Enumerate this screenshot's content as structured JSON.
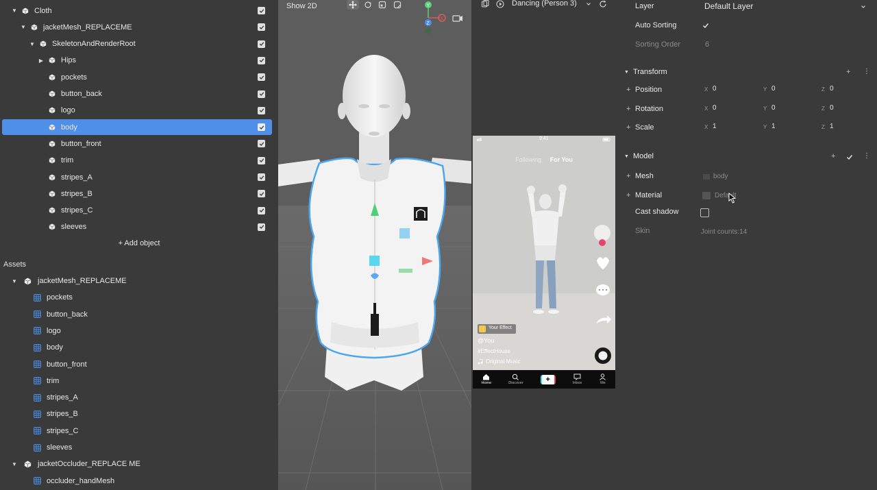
{
  "hierarchy": [
    {
      "label": "Cloth",
      "level": 0,
      "caret": "down",
      "icon": "object",
      "selected": false
    },
    {
      "label": "jacketMesh_REPLACEME",
      "level": 1,
      "caret": "down",
      "icon": "object",
      "selected": false
    },
    {
      "label": "SkeletonAndRenderRoot",
      "level": 2,
      "caret": "down",
      "icon": "object",
      "selected": false
    },
    {
      "label": "Hips",
      "level": 3,
      "caret": "right",
      "icon": "object",
      "selected": false
    },
    {
      "label": "pockets",
      "level": 3,
      "caret": "none",
      "icon": "object",
      "selected": false
    },
    {
      "label": "button_back",
      "level": 3,
      "caret": "none",
      "icon": "object",
      "selected": false
    },
    {
      "label": "logo",
      "level": 3,
      "caret": "none",
      "icon": "object",
      "selected": false
    },
    {
      "label": "body",
      "level": 3,
      "caret": "none",
      "icon": "object",
      "selected": true
    },
    {
      "label": "button_front",
      "level": 3,
      "caret": "none",
      "icon": "object",
      "selected": false
    },
    {
      "label": "trim",
      "level": 3,
      "caret": "none",
      "icon": "object",
      "selected": false
    },
    {
      "label": "stripes_A",
      "level": 3,
      "caret": "none",
      "icon": "object",
      "selected": false
    },
    {
      "label": "stripes_B",
      "level": 3,
      "caret": "none",
      "icon": "object",
      "selected": false
    },
    {
      "label": "stripes_C",
      "level": 3,
      "caret": "none",
      "icon": "object",
      "selected": false
    },
    {
      "label": "sleeves",
      "level": 3,
      "caret": "none",
      "icon": "object",
      "selected": false
    }
  ],
  "add_object_label": "+ Add object",
  "assets": {
    "title": "Assets",
    "items": [
      {
        "label": "jacketMesh_REPLACEME",
        "type": "group"
      },
      {
        "label": "pockets",
        "type": "mesh"
      },
      {
        "label": "button_back",
        "type": "mesh"
      },
      {
        "label": "logo",
        "type": "mesh"
      },
      {
        "label": "body",
        "type": "mesh"
      },
      {
        "label": "button_front",
        "type": "mesh"
      },
      {
        "label": "trim",
        "type": "mesh"
      },
      {
        "label": "stripes_A",
        "type": "mesh"
      },
      {
        "label": "stripes_B",
        "type": "mesh"
      },
      {
        "label": "stripes_C",
        "type": "mesh"
      },
      {
        "label": "sleeves",
        "type": "mesh"
      },
      {
        "label": "jacketOccluder_REPLACE ME",
        "type": "group"
      },
      {
        "label": "occluder_handMesh",
        "type": "mesh"
      }
    ]
  },
  "viewport": {
    "show2d_label": "Show 2D",
    "tools": [
      "move-tool-icon",
      "rotate-tool-icon",
      "scale-tool-icon",
      "rect-tool-icon"
    ],
    "gizmo": {
      "y": "Y",
      "x": "X",
      "z": "Z"
    }
  },
  "preview": {
    "title": "Dancing (Person 3)",
    "phone": {
      "time": "9:41",
      "tab_following": "Following",
      "tab_foryou": "For You",
      "effect_badge": "Your Effect",
      "username": "@You",
      "hashtag": "#EffectHouse",
      "music": "Original Music",
      "nav": [
        "Home",
        "Discover",
        "+",
        "Inbox",
        "Me"
      ]
    }
  },
  "properties": {
    "layer_label": "Layer",
    "layer_value": "Default Layer",
    "auto_sorting_label": "Auto Sorting",
    "sorting_order_label": "Sorting Order",
    "sorting_order_value": "6",
    "transform": {
      "title": "Transform",
      "rows": [
        {
          "label": "Position",
          "x": "0",
          "y": "0",
          "z": "0"
        },
        {
          "label": "Rotation",
          "x": "0",
          "y": "0",
          "z": "0"
        },
        {
          "label": "Scale",
          "x": "1",
          "y": "1",
          "z": "1"
        }
      ]
    },
    "axis_labels": {
      "x": "X",
      "y": "Y",
      "z": "Z"
    },
    "model": {
      "title": "Model",
      "mesh_label": "Mesh",
      "mesh_value": "body",
      "material_label": "Material",
      "material_value": "Default",
      "cast_shadow_label": "Cast shadow",
      "skin_label": "Skin",
      "skin_value": "Joint counts:14"
    }
  },
  "colors": {
    "selection": "#4f8fe8",
    "panel": "#3a3a3a",
    "viewport": "#5f5f5f",
    "mesh_icon": "#4a8ee6"
  }
}
